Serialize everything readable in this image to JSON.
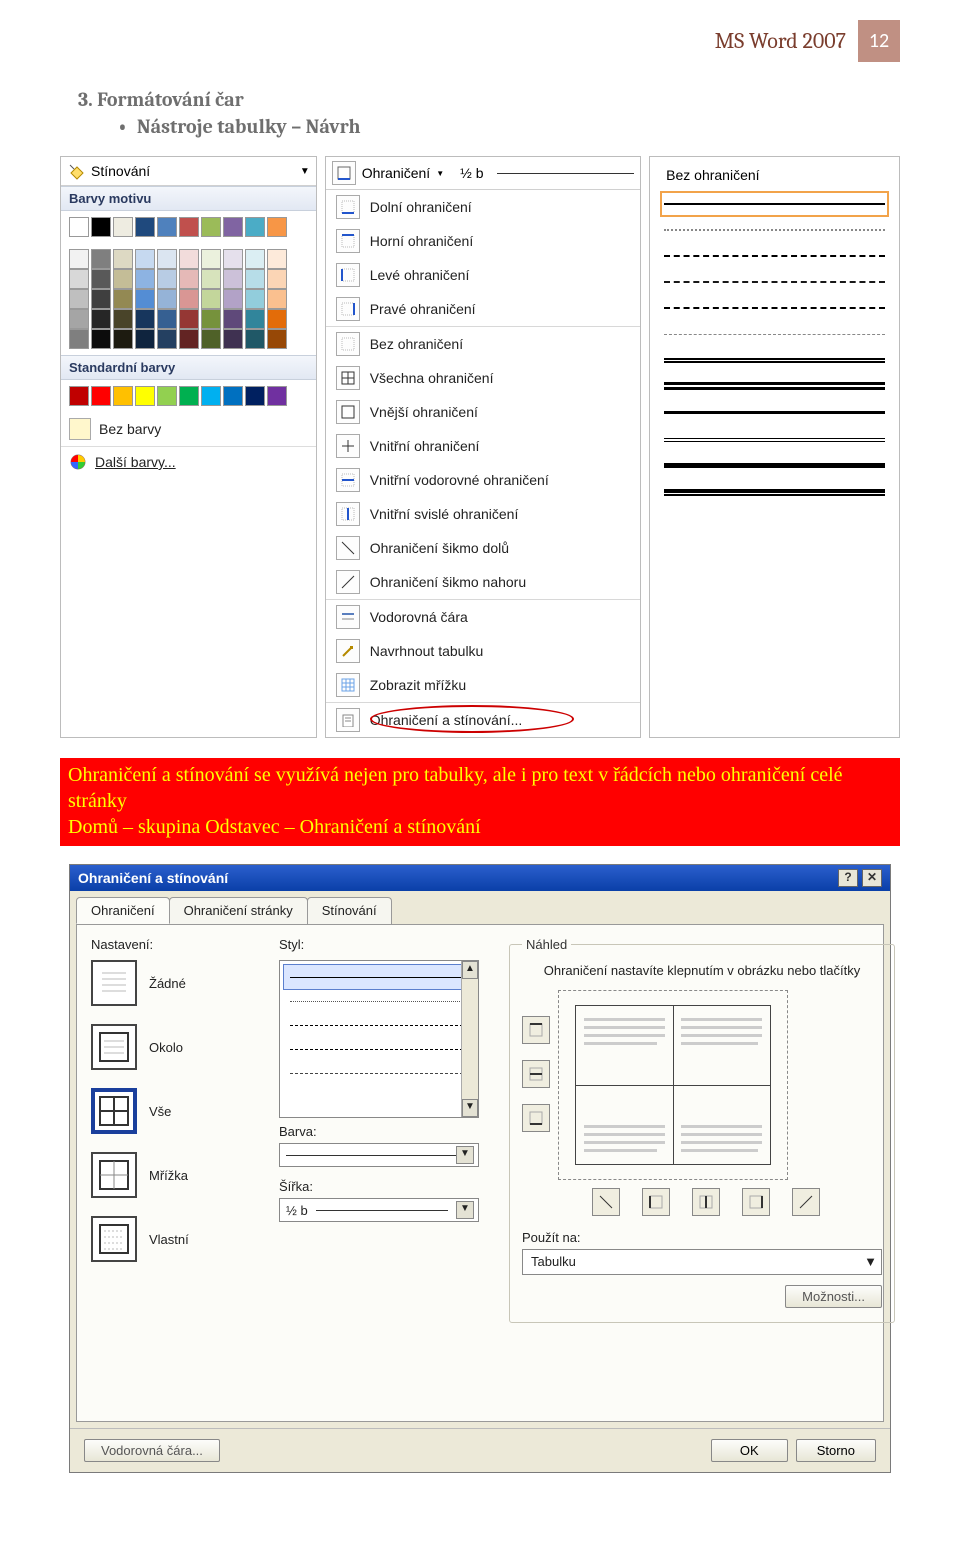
{
  "header": {
    "title": "MS Word 2007",
    "page": "12"
  },
  "section": {
    "number": "3.",
    "heading": "Formátování čar",
    "bullet": "Nástroje tabulky – Návrh"
  },
  "shading": {
    "button": "Stínování",
    "themeLabel": "Barvy motivu",
    "standardLabel": "Standardní barvy",
    "noColor": "Bez barvy",
    "moreColors": "Další barvy...",
    "themeRow": [
      "#ffffff",
      "#000000",
      "#eeece1",
      "#1f497d",
      "#4f81bd",
      "#c0504d",
      "#9bbb59",
      "#8064a2",
      "#4bacc6",
      "#f79646"
    ],
    "themeShades": [
      [
        "#f2f2f2",
        "#7f7f7f",
        "#ddd9c3",
        "#c6d9f0",
        "#dbe5f1",
        "#f2dcdb",
        "#ebf1dd",
        "#e5e0ec",
        "#dbeef3",
        "#fdeada"
      ],
      [
        "#d8d8d8",
        "#595959",
        "#c4bd97",
        "#8db3e2",
        "#b8cce4",
        "#e5b9b7",
        "#d7e3bc",
        "#ccc1d9",
        "#b7dde8",
        "#fbd5b5"
      ],
      [
        "#bfbfbf",
        "#3f3f3f",
        "#938953",
        "#548dd4",
        "#95b3d7",
        "#d99694",
        "#c3d69b",
        "#b2a2c7",
        "#92cddc",
        "#fac08f"
      ],
      [
        "#a5a5a5",
        "#262626",
        "#494429",
        "#17365d",
        "#366092",
        "#953734",
        "#76923c",
        "#5f497a",
        "#31859b",
        "#e36c09"
      ],
      [
        "#7f7f7f",
        "#0c0c0c",
        "#1d1b10",
        "#0f243e",
        "#244061",
        "#632423",
        "#4f6128",
        "#3f3151",
        "#205867",
        "#974806"
      ]
    ],
    "standardRow": [
      "#c00000",
      "#ff0000",
      "#ffc000",
      "#ffff00",
      "#92d050",
      "#00b050",
      "#00b0f0",
      "#0070c0",
      "#002060",
      "#7030a0"
    ]
  },
  "borders": {
    "button": "Ohraničení",
    "width": "½ b",
    "items": [
      "Dolní ohraničení",
      "Horní ohraničení",
      "Levé ohraničení",
      "Pravé ohraničení",
      "Bez ohraničení",
      "Všechna ohraničení",
      "Vnější ohraničení",
      "Vnitřní ohraničení",
      "Vnitřní vodorovné ohraničení",
      "Vnitřní svislé ohraničení",
      "Ohraničení šikmo dolů",
      "Ohraničení šikmo nahoru",
      "Vodorovná čára",
      "Navrhnout tabulku",
      "Zobrazit mřížku",
      "Ohraničení a stínování..."
    ]
  },
  "lines": {
    "noBorder": "Bez ohraničení",
    "styles": [
      {
        "css": "border-top:2px solid #000;",
        "sel": true
      },
      {
        "css": "border-top:2px dotted #888;"
      },
      {
        "css": "border-top:2px dashed #000;"
      },
      {
        "css": "border-top:2px dashed #000; opacity:.9;"
      },
      {
        "css": "border-top:2px dashed #000;"
      },
      {
        "css": "border-top:1px dashed #888;"
      },
      {
        "css": "border-top:5px double #000;"
      },
      {
        "css": "border-top:8px double #000;"
      },
      {
        "css": "border-top:3px solid #000;"
      },
      {
        "css": "border-top:1px solid #000;box-shadow:0 3px 0 #000;"
      },
      {
        "css": "border-top:3px solid #000;box-shadow:0 2px 0 #000;"
      },
      {
        "css": "border-top:2px solid #000;box-shadow:0 2px 0 #000,0 5px 0 #000;"
      }
    ]
  },
  "redBox": {
    "line1": "Ohraničení a stínování se využívá nejen pro tabulky, ale i pro text v řádcích nebo ohraničení celé stránky",
    "line2": "Domů – skupina Odstavec – Ohraničení a stínování"
  },
  "dialog": {
    "title": "Ohraničení a stínování",
    "tabs": [
      "Ohraničení",
      "Ohraničení stránky",
      "Stínování"
    ],
    "colNastaveni": "Nastavení:",
    "settings": [
      "Žádné",
      "Okolo",
      "Vše",
      "Mřížka",
      "Vlastní"
    ],
    "colStyl": "Styl:",
    "barva": "Barva:",
    "sirka": "Šířka:",
    "sirkaVal": "½ b",
    "nahled": "Náhled",
    "nahledText": "Ohraničení nastavíte klepnutím v obrázku nebo tlačítky",
    "pouzit": "Použít na:",
    "pouzitVal": "Tabulku",
    "moznosti": "Možnosti...",
    "hline": "Vodorovná čára...",
    "ok": "OK",
    "cancel": "Storno"
  }
}
